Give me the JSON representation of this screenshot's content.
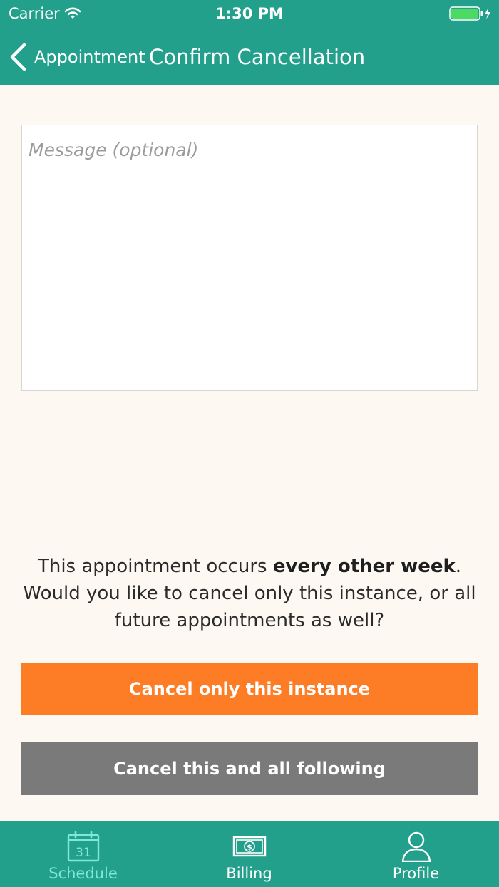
{
  "status_bar": {
    "carrier": "Carrier",
    "time": "1:30 PM"
  },
  "nav": {
    "back_label": "Appointment",
    "title": "Confirm Cancellation"
  },
  "form": {
    "message_placeholder": "Message (optional)",
    "message_value": ""
  },
  "info": {
    "prefix": "This appointment occurs ",
    "emphasis": "every other week",
    "suffix": ". Would you like to cancel only this instance, or all future appointments as well?"
  },
  "actions": {
    "cancel_instance_label": "Cancel only this instance",
    "cancel_following_label": "Cancel this and all following"
  },
  "tab_bar": {
    "schedule": {
      "label": "Schedule",
      "icon": "calendar-icon",
      "calendar_day": "31",
      "active": true
    },
    "billing": {
      "label": "Billing",
      "icon": "dollar-bill-icon",
      "active": false
    },
    "profile": {
      "label": "Profile",
      "icon": "person-icon",
      "active": false
    }
  },
  "colors": {
    "brand": "#23a08c",
    "accent": "#fc7d26",
    "secondary_button": "#7a7a7a",
    "active_tab": "#7fe9d8",
    "background": "#fdf8f2"
  }
}
